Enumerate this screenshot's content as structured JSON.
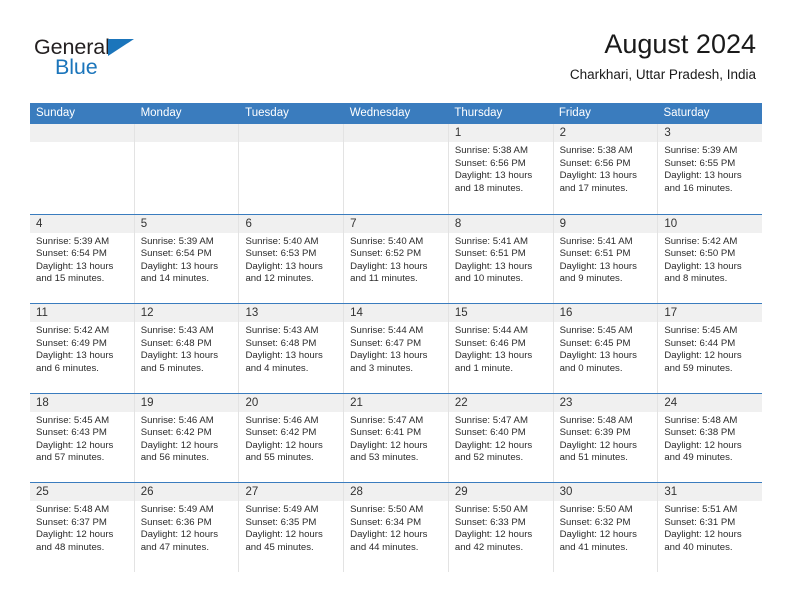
{
  "brand": {
    "name_top": "General",
    "name_bottom": "Blue",
    "accent_color": "#1b75bb"
  },
  "header": {
    "title": "August 2024",
    "subtitle": "Charkhari, Uttar Pradesh, India"
  },
  "calendar": {
    "header_color": "#3a7cbe",
    "weekdays": [
      "Sunday",
      "Monday",
      "Tuesday",
      "Wednesday",
      "Thursday",
      "Friday",
      "Saturday"
    ],
    "weeks": [
      [
        {
          "day": "",
          "sunrise": "",
          "sunset": "",
          "daylight": "",
          "empty": true
        },
        {
          "day": "",
          "sunrise": "",
          "sunset": "",
          "daylight": "",
          "empty": true
        },
        {
          "day": "",
          "sunrise": "",
          "sunset": "",
          "daylight": "",
          "empty": true
        },
        {
          "day": "",
          "sunrise": "",
          "sunset": "",
          "daylight": "",
          "empty": true
        },
        {
          "day": "1",
          "sunrise": "Sunrise: 5:38 AM",
          "sunset": "Sunset: 6:56 PM",
          "daylight": "Daylight: 13 hours and 18 minutes.",
          "empty": false
        },
        {
          "day": "2",
          "sunrise": "Sunrise: 5:38 AM",
          "sunset": "Sunset: 6:56 PM",
          "daylight": "Daylight: 13 hours and 17 minutes.",
          "empty": false
        },
        {
          "day": "3",
          "sunrise": "Sunrise: 5:39 AM",
          "sunset": "Sunset: 6:55 PM",
          "daylight": "Daylight: 13 hours and 16 minutes.",
          "empty": false
        }
      ],
      [
        {
          "day": "4",
          "sunrise": "Sunrise: 5:39 AM",
          "sunset": "Sunset: 6:54 PM",
          "daylight": "Daylight: 13 hours and 15 minutes.",
          "empty": false
        },
        {
          "day": "5",
          "sunrise": "Sunrise: 5:39 AM",
          "sunset": "Sunset: 6:54 PM",
          "daylight": "Daylight: 13 hours and 14 minutes.",
          "empty": false
        },
        {
          "day": "6",
          "sunrise": "Sunrise: 5:40 AM",
          "sunset": "Sunset: 6:53 PM",
          "daylight": "Daylight: 13 hours and 12 minutes.",
          "empty": false
        },
        {
          "day": "7",
          "sunrise": "Sunrise: 5:40 AM",
          "sunset": "Sunset: 6:52 PM",
          "daylight": "Daylight: 13 hours and 11 minutes.",
          "empty": false
        },
        {
          "day": "8",
          "sunrise": "Sunrise: 5:41 AM",
          "sunset": "Sunset: 6:51 PM",
          "daylight": "Daylight: 13 hours and 10 minutes.",
          "empty": false
        },
        {
          "day": "9",
          "sunrise": "Sunrise: 5:41 AM",
          "sunset": "Sunset: 6:51 PM",
          "daylight": "Daylight: 13 hours and 9 minutes.",
          "empty": false
        },
        {
          "day": "10",
          "sunrise": "Sunrise: 5:42 AM",
          "sunset": "Sunset: 6:50 PM",
          "daylight": "Daylight: 13 hours and 8 minutes.",
          "empty": false
        }
      ],
      [
        {
          "day": "11",
          "sunrise": "Sunrise: 5:42 AM",
          "sunset": "Sunset: 6:49 PM",
          "daylight": "Daylight: 13 hours and 6 minutes.",
          "empty": false
        },
        {
          "day": "12",
          "sunrise": "Sunrise: 5:43 AM",
          "sunset": "Sunset: 6:48 PM",
          "daylight": "Daylight: 13 hours and 5 minutes.",
          "empty": false
        },
        {
          "day": "13",
          "sunrise": "Sunrise: 5:43 AM",
          "sunset": "Sunset: 6:48 PM",
          "daylight": "Daylight: 13 hours and 4 minutes.",
          "empty": false
        },
        {
          "day": "14",
          "sunrise": "Sunrise: 5:44 AM",
          "sunset": "Sunset: 6:47 PM",
          "daylight": "Daylight: 13 hours and 3 minutes.",
          "empty": false
        },
        {
          "day": "15",
          "sunrise": "Sunrise: 5:44 AM",
          "sunset": "Sunset: 6:46 PM",
          "daylight": "Daylight: 13 hours and 1 minute.",
          "empty": false
        },
        {
          "day": "16",
          "sunrise": "Sunrise: 5:45 AM",
          "sunset": "Sunset: 6:45 PM",
          "daylight": "Daylight: 13 hours and 0 minutes.",
          "empty": false
        },
        {
          "day": "17",
          "sunrise": "Sunrise: 5:45 AM",
          "sunset": "Sunset: 6:44 PM",
          "daylight": "Daylight: 12 hours and 59 minutes.",
          "empty": false
        }
      ],
      [
        {
          "day": "18",
          "sunrise": "Sunrise: 5:45 AM",
          "sunset": "Sunset: 6:43 PM",
          "daylight": "Daylight: 12 hours and 57 minutes.",
          "empty": false
        },
        {
          "day": "19",
          "sunrise": "Sunrise: 5:46 AM",
          "sunset": "Sunset: 6:42 PM",
          "daylight": "Daylight: 12 hours and 56 minutes.",
          "empty": false
        },
        {
          "day": "20",
          "sunrise": "Sunrise: 5:46 AM",
          "sunset": "Sunset: 6:42 PM",
          "daylight": "Daylight: 12 hours and 55 minutes.",
          "empty": false
        },
        {
          "day": "21",
          "sunrise": "Sunrise: 5:47 AM",
          "sunset": "Sunset: 6:41 PM",
          "daylight": "Daylight: 12 hours and 53 minutes.",
          "empty": false
        },
        {
          "day": "22",
          "sunrise": "Sunrise: 5:47 AM",
          "sunset": "Sunset: 6:40 PM",
          "daylight": "Daylight: 12 hours and 52 minutes.",
          "empty": false
        },
        {
          "day": "23",
          "sunrise": "Sunrise: 5:48 AM",
          "sunset": "Sunset: 6:39 PM",
          "daylight": "Daylight: 12 hours and 51 minutes.",
          "empty": false
        },
        {
          "day": "24",
          "sunrise": "Sunrise: 5:48 AM",
          "sunset": "Sunset: 6:38 PM",
          "daylight": "Daylight: 12 hours and 49 minutes.",
          "empty": false
        }
      ],
      [
        {
          "day": "25",
          "sunrise": "Sunrise: 5:48 AM",
          "sunset": "Sunset: 6:37 PM",
          "daylight": "Daylight: 12 hours and 48 minutes.",
          "empty": false
        },
        {
          "day": "26",
          "sunrise": "Sunrise: 5:49 AM",
          "sunset": "Sunset: 6:36 PM",
          "daylight": "Daylight: 12 hours and 47 minutes.",
          "empty": false
        },
        {
          "day": "27",
          "sunrise": "Sunrise: 5:49 AM",
          "sunset": "Sunset: 6:35 PM",
          "daylight": "Daylight: 12 hours and 45 minutes.",
          "empty": false
        },
        {
          "day": "28",
          "sunrise": "Sunrise: 5:50 AM",
          "sunset": "Sunset: 6:34 PM",
          "daylight": "Daylight: 12 hours and 44 minutes.",
          "empty": false
        },
        {
          "day": "29",
          "sunrise": "Sunrise: 5:50 AM",
          "sunset": "Sunset: 6:33 PM",
          "daylight": "Daylight: 12 hours and 42 minutes.",
          "empty": false
        },
        {
          "day": "30",
          "sunrise": "Sunrise: 5:50 AM",
          "sunset": "Sunset: 6:32 PM",
          "daylight": "Daylight: 12 hours and 41 minutes.",
          "empty": false
        },
        {
          "day": "31",
          "sunrise": "Sunrise: 5:51 AM",
          "sunset": "Sunset: 6:31 PM",
          "daylight": "Daylight: 12 hours and 40 minutes.",
          "empty": false
        }
      ]
    ]
  }
}
